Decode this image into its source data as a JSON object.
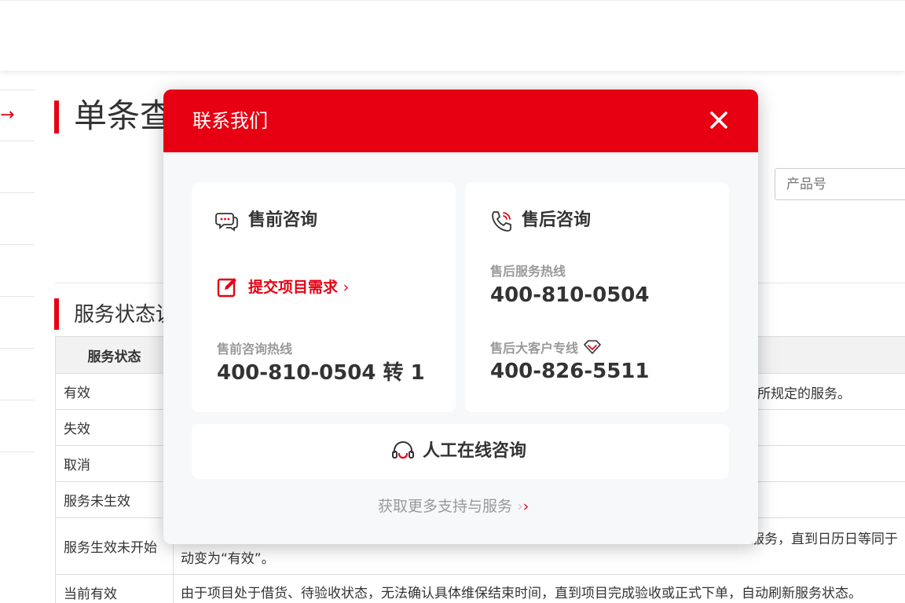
{
  "page": {
    "title": "单条查",
    "section_title": "服务状态说",
    "product_placeholder": "产品号",
    "table": {
      "header": "服务状态",
      "rows": [
        {
          "status": "有效"
        },
        {
          "status": "失效"
        },
        {
          "status": "取消"
        },
        {
          "status": "服务未生效"
        },
        {
          "status": "服务生效未开始"
        },
        {
          "status": "当前有效"
        }
      ],
      "visible_desc": {
        "row1": "所规定的服务。",
        "row5_a": "服务，直到日历日等同于",
        "row5_b": "动变为“有效”。",
        "row6": "由于项目处于借货、待验收状态，无法确认具体维保结束时间，直到项目完成验收或正式下单，自动刷新服务状态。"
      }
    }
  },
  "modal": {
    "title": "联系我们",
    "presales": {
      "title": "售前咨询",
      "submit_link": "提交项目需求",
      "hotline_label": "售前咨询热线",
      "hotline": "400-810-0504 转 1"
    },
    "aftersales": {
      "title": "售后咨询",
      "hotline_label": "售后服务热线",
      "hotline": "400-810-0504",
      "vip_label": "售后大客户专线",
      "vip_hotline": "400-826-5511"
    },
    "online": {
      "label": "人工在线咨询"
    },
    "more": {
      "label": "获取更多支持与服务",
      "arrows": "›"
    }
  },
  "icons": {
    "chat": "chat-bubbles-icon",
    "phone": "phone-icon",
    "edit": "edit-icon",
    "diamond": "diamond-icon",
    "headset": "headset-icon",
    "close": "close-icon",
    "arrow": "arrow-right-icon"
  },
  "colors": {
    "brand_red": "#e60012",
    "modal_bg": "#f7f8fa",
    "text": "#333333",
    "muted": "#999999"
  }
}
